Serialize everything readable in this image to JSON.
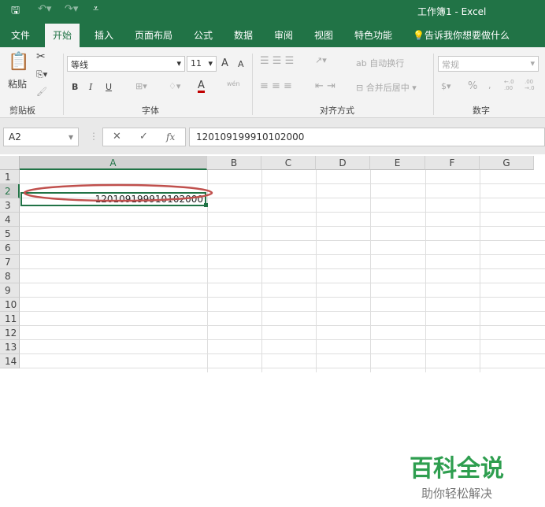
{
  "title": "工作簿1 - Excel",
  "quick_access": {
    "save_icon": "save-icon",
    "undo_icon": "undo-icon",
    "redo_icon": "redo-icon",
    "customize_icon": "customize-icon"
  },
  "tabs": [
    "文件",
    "开始",
    "插入",
    "页面布局",
    "公式",
    "数据",
    "审阅",
    "视图",
    "特色功能"
  ],
  "active_tab": "开始",
  "tell_me": "告诉我你想要做什么",
  "ribbon": {
    "clipboard": {
      "paste": "粘贴",
      "group": "剪贴板"
    },
    "font": {
      "name": "等线",
      "size": "11",
      "bold": "B",
      "italic": "I",
      "underline": "U",
      "grow": "A",
      "shrink": "A",
      "font_color": "A",
      "phonetic": "wén",
      "group": "字体",
      "font_color_hex": "#c00000"
    },
    "alignment": {
      "wrap": "自动换行",
      "merge": "合并后居中",
      "group": "对齐方式"
    },
    "number": {
      "format": "常规",
      "percent": "%",
      "comma": ",",
      "inc": "←.0 .00",
      "dec": ".00 →.0",
      "group": "数字"
    }
  },
  "formula_bar": {
    "name_box": "A2",
    "cancel": "✕",
    "enter": "✓",
    "fx": "fx",
    "value": "120109199910102000"
  },
  "columns": [
    "A",
    "B",
    "C",
    "D",
    "E",
    "F",
    "G"
  ],
  "rows": [
    "1",
    "2",
    "3",
    "4",
    "5",
    "6",
    "7",
    "8",
    "9",
    "10",
    "11",
    "12",
    "13",
    "14"
  ],
  "cells": {
    "A2": "120109199910102000"
  },
  "annotation_color": "#c0504d",
  "accent": "#217346",
  "watermark": {
    "title": "百科全说",
    "subtitle": "助你轻松解决"
  }
}
